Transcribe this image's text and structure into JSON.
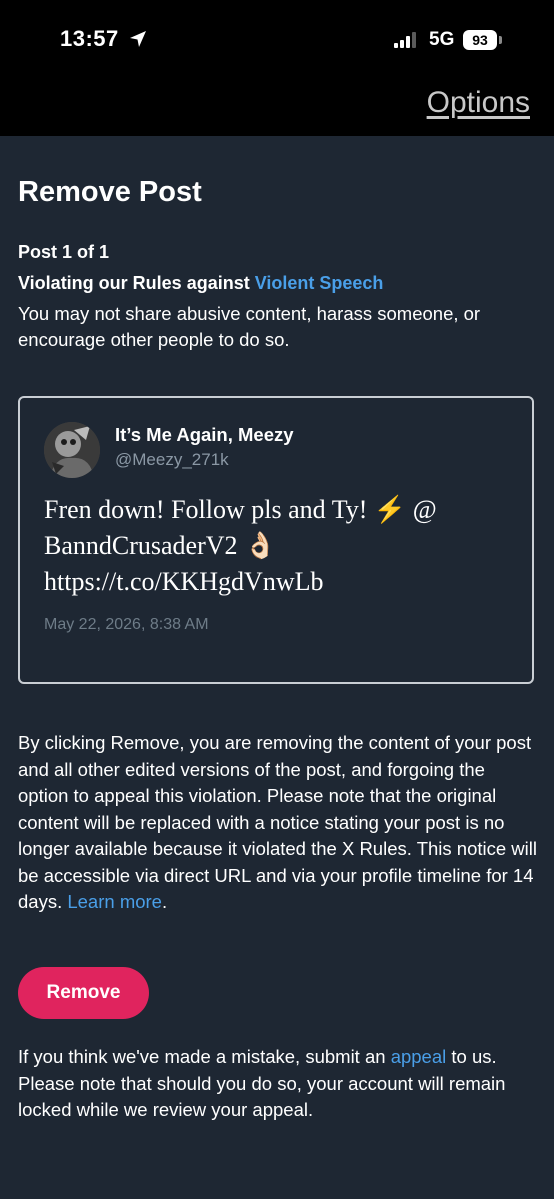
{
  "status_bar": {
    "time": "13:57",
    "network": "5G",
    "battery": "93"
  },
  "nav": {
    "options_label": "Options"
  },
  "page": {
    "title": "Remove Post",
    "post_count": "Post 1 of 1",
    "violation_prefix": "Violating our Rules against ",
    "violation_rule": "Violent Speech",
    "violation_description": "You may not share abusive content, harass someone, or encourage other people to do so."
  },
  "post": {
    "author_name": "It’s Me Again, Meezy",
    "author_handle": "@Meezy_271k",
    "text_line1": "Fren down! Follow pls and Ty! ⚡ @",
    "text_line2": "BanndCrusaderV2 👌🏻",
    "text_line3": "https://t.co/KKHgdVnwLb",
    "date": "May 22, 2026, 8:38 AM"
  },
  "notice": {
    "removal_text": "By clicking Remove, you are removing the content of your post and all other edited versions of the post, and forgoing the option to appeal this violation. Please note that the original content will be replaced with a notice stating your post is no longer available because it violated the X Rules. This notice will be accessible via direct URL and via your profile timeline for 14 days. ",
    "learn_more": "Learn more",
    "learn_more_suffix": ".",
    "remove_button": "Remove",
    "appeal_prefix": "If you think we've made a mistake, submit an ",
    "appeal_link": "appeal",
    "appeal_suffix": " to us. Please note that should you do so, your account will remain locked while we review your appeal."
  },
  "colors": {
    "background": "#1e2733",
    "link": "#4a9fe8",
    "remove_button": "#e0245e",
    "muted_text": "#8b98a5"
  },
  "icons": [
    "location-arrow-icon",
    "signal-bars-icon",
    "battery-icon"
  ]
}
